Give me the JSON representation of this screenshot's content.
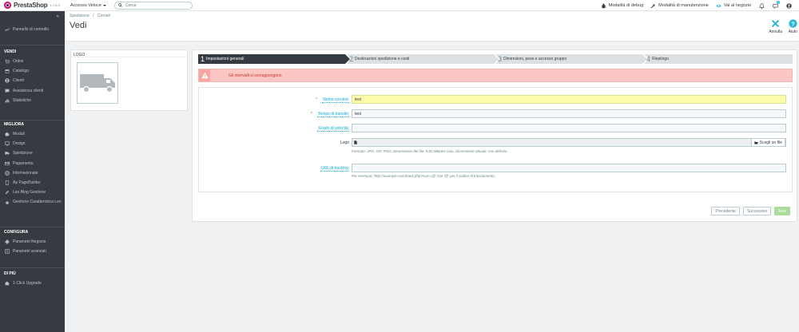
{
  "topbar": {
    "brand": "PrestaShop",
    "version": "1.7.6.3",
    "quick_access": "Accesso Veloce",
    "search_placeholder": "Cerca",
    "debug": "Modalità di debug",
    "maintenance": "Modalità di manutenzione",
    "store": "Vai al negozio",
    "notif_count": "1"
  },
  "sidebar": {
    "dashboard": "Pannello di controllo",
    "sections": [
      {
        "title": "VENDI",
        "items": [
          "Ordini",
          "Catalogo",
          "Clienti",
          "Assistenza clienti",
          "Statistiche"
        ]
      },
      {
        "title": "MIGLIORA",
        "items": [
          "Moduli",
          "Design",
          "Spedizione",
          "Pagamento",
          "Internazionale",
          "Ap PageBuilder",
          "Leo Blog Gestione",
          "Gestione Caratteristica Leo"
        ]
      },
      {
        "title": "CONFIGURA",
        "items": [
          "Parametri Negozio",
          "Parametri avanzati"
        ]
      },
      {
        "title": "DI PIÙ",
        "items": [
          "1-Click Upgrade"
        ]
      }
    ]
  },
  "header": {
    "breadcrumb_parent": "Spedizione",
    "breadcrumb_sep": "/",
    "breadcrumb_current": "Corrieri",
    "title": "Vedi",
    "cancel": "Annulla",
    "help": "Aiuto"
  },
  "logo_panel": {
    "heading": "LOGO"
  },
  "wizard": {
    "steps": [
      {
        "num": "1",
        "label": "Impostazioni generali",
        "active": true
      },
      {
        "num": "2",
        "label": "Destinazioni spedizione e costi",
        "active": false
      },
      {
        "num": "3",
        "label": "Dimensioni, peso e accesso gruppo",
        "active": false
      },
      {
        "num": "4",
        "label": "Riepilogo",
        "active": false
      }
    ],
    "alert": "Gli intervalli si sovrappongono"
  },
  "form": {
    "name_label": "Nome corriere",
    "name_value": "test",
    "transit_label": "Tempo di transito",
    "transit_value": "test",
    "speed_label": "Grado di velocità",
    "speed_value": "",
    "logo_label": "Logo",
    "file_button": "Scegli un file",
    "logo_help": "Formato: JPG, GIF, PNG. Dimensione del file: 8,00 MBytes max. Dimensione attuale: non definita.",
    "tracking_label": "URL di tracking",
    "tracking_value": "",
    "tracking_help": "Per esempio: 'http://example.com/track.php?num=@' con '@' per il codice di tracciamento."
  },
  "nav": {
    "prev": "Precedente",
    "next": "Successivo",
    "finish": "Fine"
  },
  "colors": {
    "sidebar_bg": "#363a41",
    "accent": "#25b9d7",
    "brand": "#df0067",
    "alert_bg": "#fbc6c3",
    "finish_bg": "#a9dc9b"
  }
}
